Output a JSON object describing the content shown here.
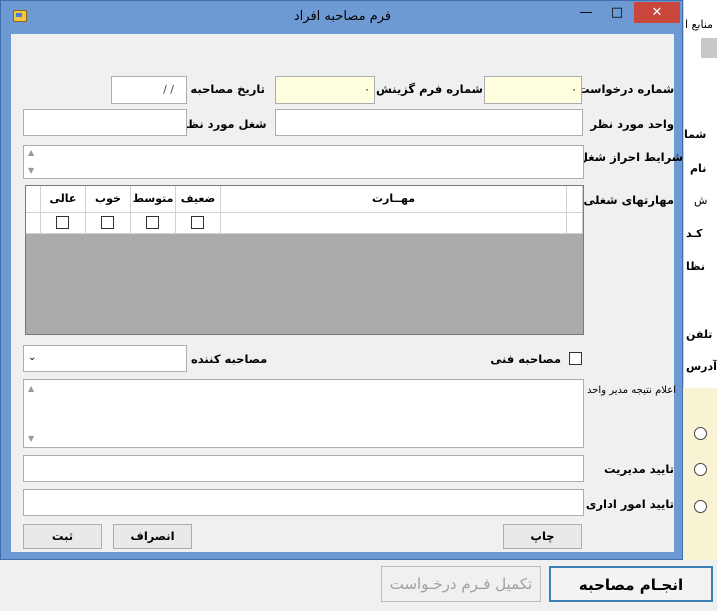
{
  "background_window": {
    "partial_labels": [
      "منابع ا",
      "شما",
      "نام",
      "ش",
      "کـد",
      "نظا",
      "تلفن",
      "آدرس"
    ],
    "complete_button_label": "تکمیل فـرم درخـواست",
    "interview_button_label": "انجـام مصاحبه"
  },
  "dialog": {
    "title": "فرم مصاحبه افراد",
    "minimize_glyph": "—",
    "maximize_glyph": "□",
    "close_glyph": "✕",
    "fields": {
      "request_number_label": "شماره درخواست",
      "request_number_value": "۰",
      "selection_form_number_label": "شماره فرم گزینش",
      "selection_form_number_value": "۰",
      "interview_date_label": "تاریخ مصاحبه",
      "interview_date_value": "/ /",
      "unit_label": "واحد مورد نظر",
      "job_label": "شغل مورد نظر",
      "job_requirements_label": "شرایط احراز شغل",
      "job_skills_label": "مهارتهای شغلی",
      "technical_interview_label": "مصاحبه فنی",
      "interviewer_label": "مصاحبه کننده",
      "unit_manager_result_label": "اعلام نتیجه مدیر واحد",
      "management_approval_label": "تایید مدیریت",
      "admin_approval_label": "تایید امور اداری"
    },
    "skills_grid": {
      "columns": [
        "مهــارت",
        "ضعیف",
        "متوسط",
        "خوب",
        "عالی"
      ]
    },
    "buttons": {
      "print": "چاپ",
      "cancel": "انصراف",
      "submit": "ثبت"
    }
  },
  "colors": {
    "titlebar_blue": "#6e9ad3",
    "close_red": "#c9463d",
    "required_field_yellow": "#ffffe0"
  }
}
